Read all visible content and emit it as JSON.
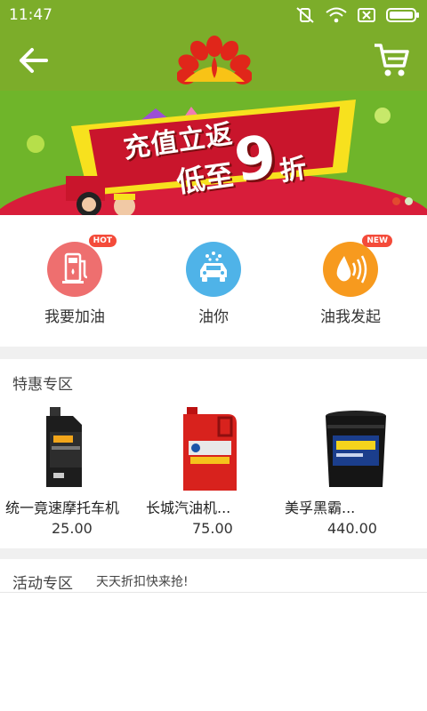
{
  "status_bar": {
    "time": "11:47"
  },
  "icons": {
    "back": "arrow-left-icon",
    "logo": "petrochina-logo",
    "cart": "shopping-cart-icon",
    "mute": "vibrate-off-icon",
    "wifi": "wifi-icon",
    "sim": "no-sim-icon",
    "battery": "battery-icon"
  },
  "colors": {
    "header": "#7cad2a",
    "banner_green": "#6fb52a",
    "banner_red": "#c9152c",
    "banner_yellow": "#f7e11e"
  },
  "banner": {
    "line1": "充值立返",
    "line2": "低至",
    "big": "9",
    "suffix": "折",
    "page": 1,
    "pages": 2
  },
  "quick_actions": [
    {
      "label": "我要加油",
      "badge": "HOT",
      "icon": "fuel-pump-icon",
      "color": "#ee6f6f"
    },
    {
      "label": "油你",
      "badge": "",
      "icon": "car-wash-icon",
      "color": "#4fb3e8"
    },
    {
      "label": "油我发起",
      "badge": "NEW",
      "icon": "oil-drop-signal-icon",
      "color": "#f79a1e"
    }
  ],
  "specials": {
    "title": "特惠专区",
    "products": [
      {
        "name": "统一竟速摩托车机",
        "price": "25.00"
      },
      {
        "name": "长城汽油机...",
        "price": "75.00"
      },
      {
        "name": "美孚黑霸...",
        "price": "440.00"
      }
    ]
  },
  "activities": {
    "title": "活动专区",
    "subtitle": "天天折扣快来抢!"
  }
}
